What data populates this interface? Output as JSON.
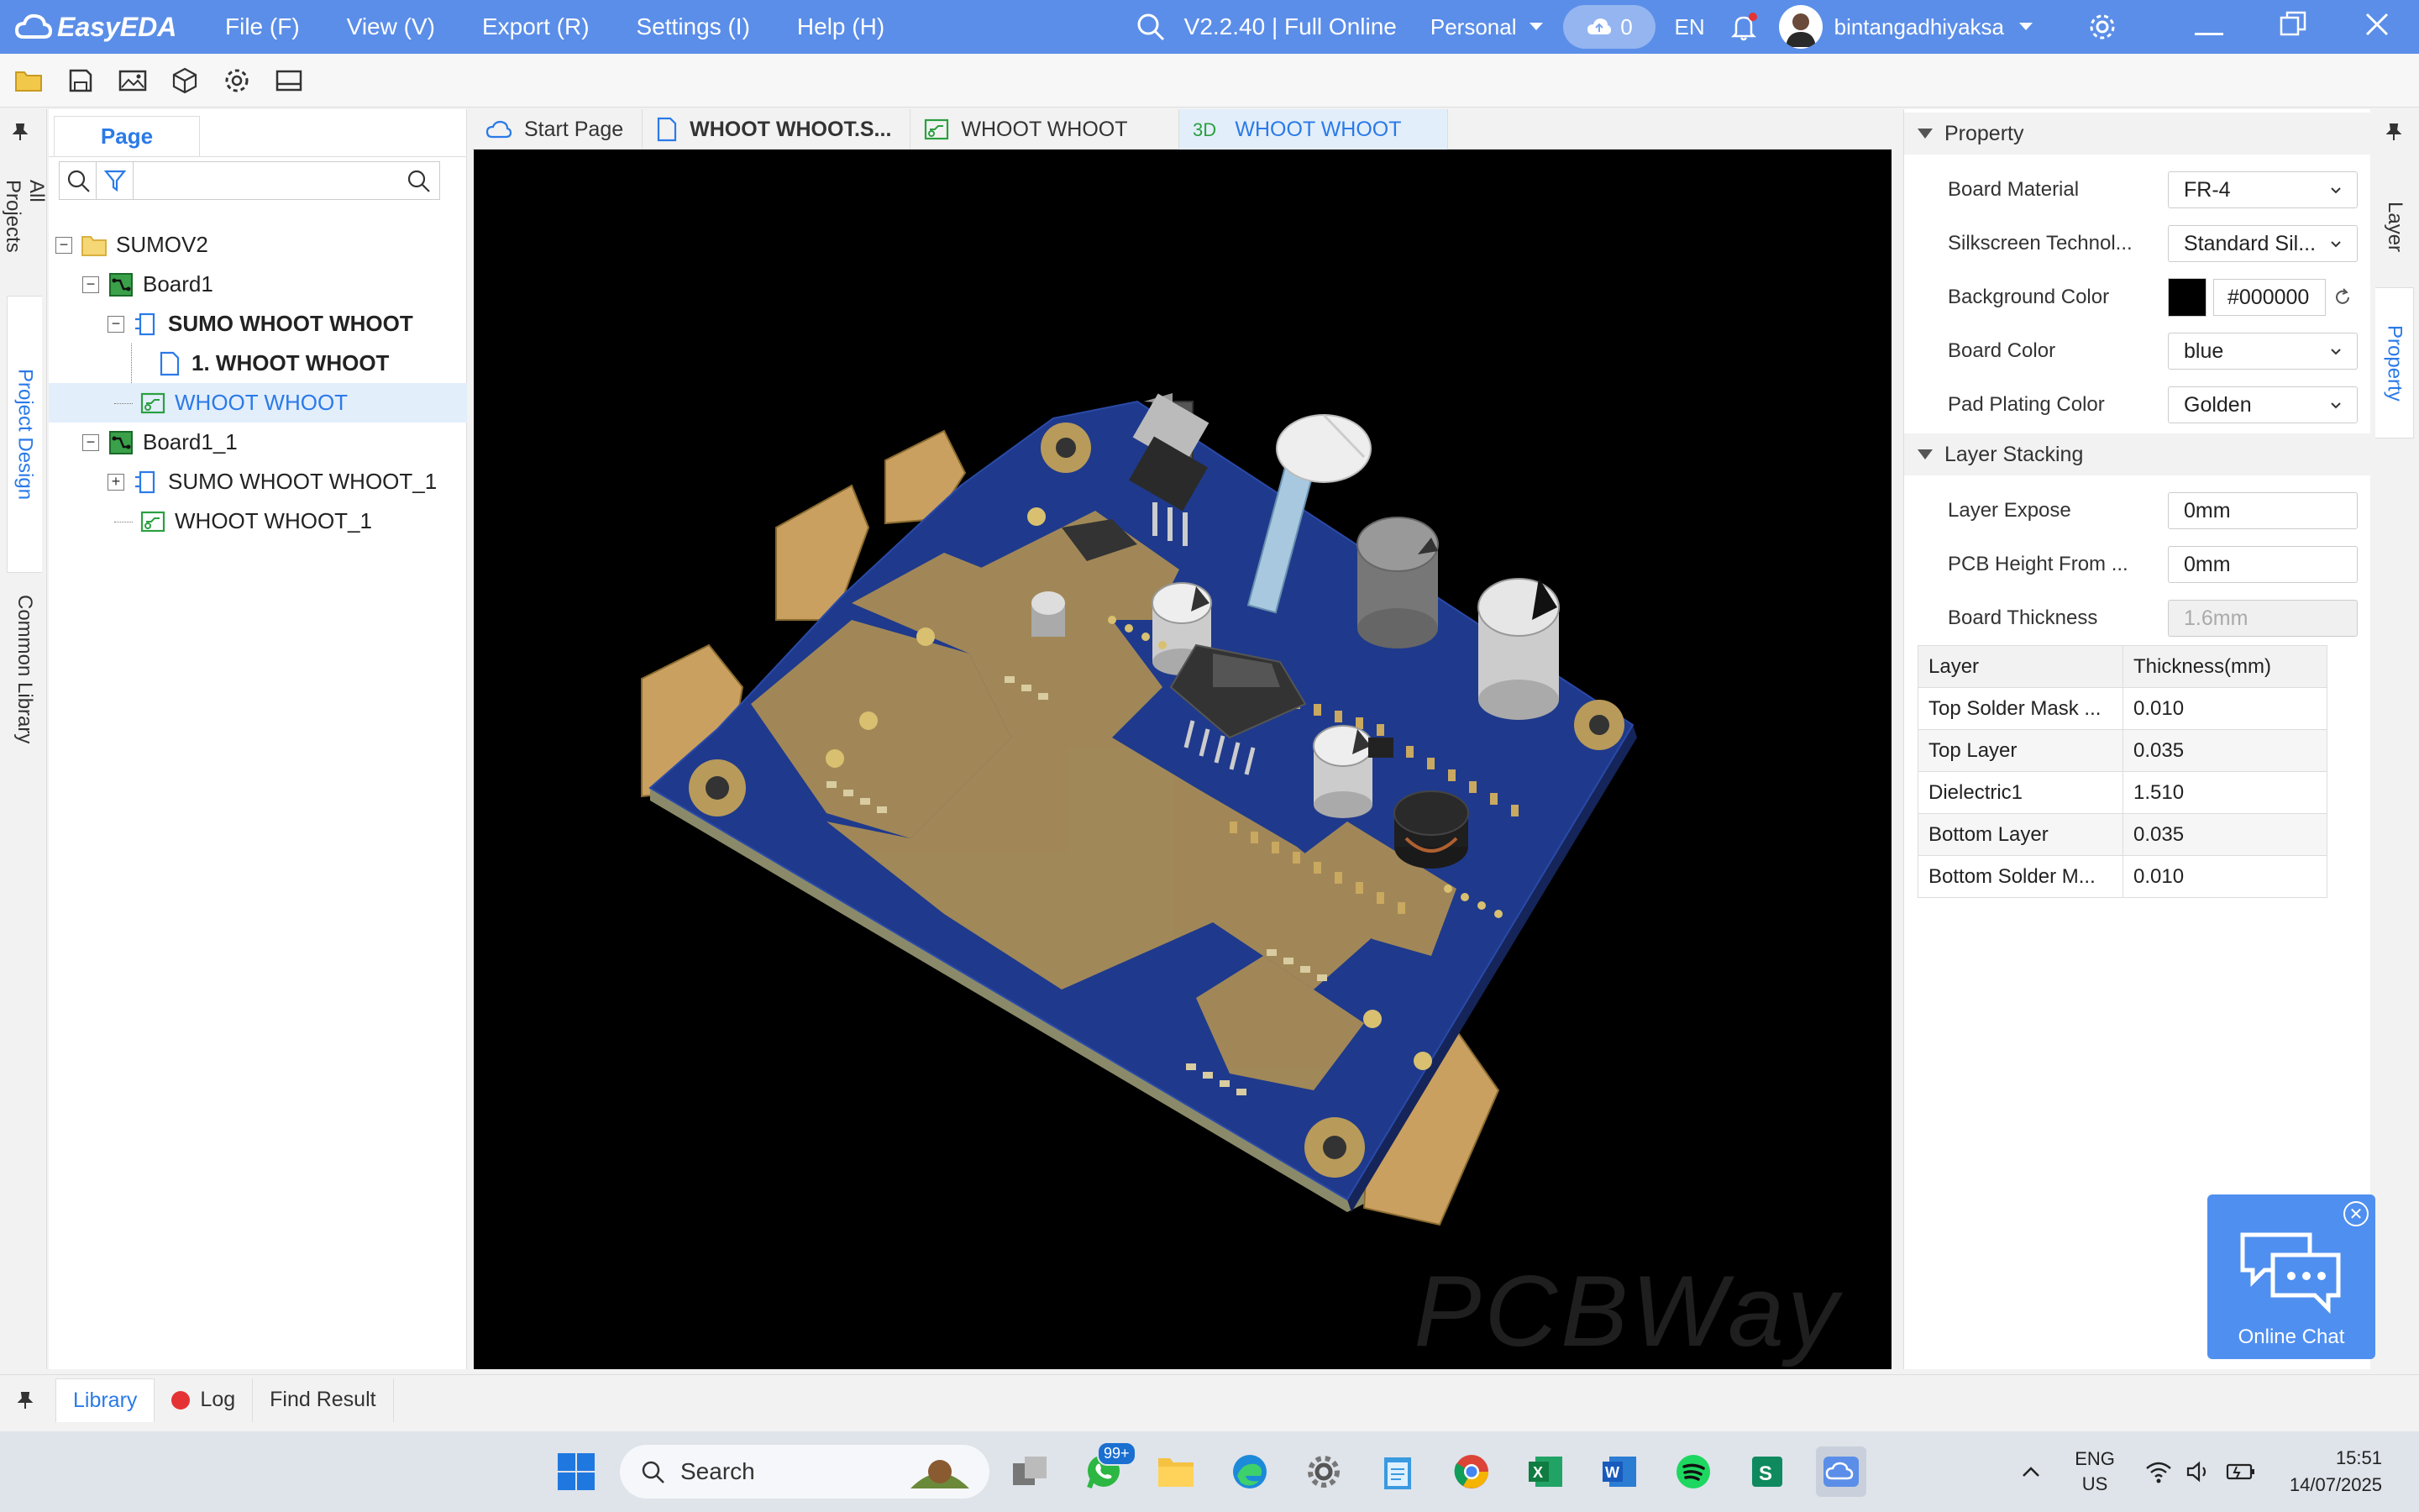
{
  "app": {
    "title": "EasyEDA"
  },
  "menu": [
    "File (F)",
    "View (V)",
    "Export (R)",
    "Settings (I)",
    "Help (H)"
  ],
  "titlebar": {
    "version": "V2.2.40 | Full Online",
    "workspace": "Personal",
    "cloud_count": "0",
    "lang": "EN",
    "username": "bintangadhiyaksa"
  },
  "left_rail": {
    "tabs": [
      "All Projects",
      "Project Design",
      "Common Library"
    ],
    "active": "Project Design"
  },
  "page_panel": {
    "tab": "Page",
    "search_placeholder": ""
  },
  "tree": [
    {
      "label": "SUMOV2",
      "level": 0,
      "icon": "folder",
      "expander": "-"
    },
    {
      "label": "Board1",
      "level": 1,
      "icon": "board",
      "expander": "-"
    },
    {
      "label": "SUMO WHOOT WHOOT",
      "level": 2,
      "icon": "schematic",
      "expander": "-",
      "bold": true
    },
    {
      "label": "1. WHOOT WHOOT",
      "level": 3,
      "icon": "page",
      "bold": true
    },
    {
      "label": "WHOOT WHOOT",
      "level": 2,
      "icon": "pcb",
      "selected": true
    },
    {
      "label": "Board1_1",
      "level": 1,
      "icon": "board",
      "expander": "-"
    },
    {
      "label": "SUMO WHOOT WHOOT_1",
      "level": 2,
      "icon": "schematic",
      "expander": "+"
    },
    {
      "label": "WHOOT WHOOT_1",
      "level": 2,
      "icon": "pcb"
    }
  ],
  "tabs": [
    {
      "label": "Start Page",
      "icon": "cloud"
    },
    {
      "label": "WHOOT WHOOT.S...",
      "icon": "page",
      "bold": true
    },
    {
      "label": "WHOOT WHOOT",
      "icon": "pcb"
    },
    {
      "label": "WHOOT WHOOT",
      "icon": "3d",
      "active": true
    }
  ],
  "property": {
    "section_property": "Property",
    "rows": [
      {
        "label": "Board Material",
        "value": "FR-4",
        "type": "select"
      },
      {
        "label": "Silkscreen Technol...",
        "value": "Standard Sil...",
        "type": "select"
      },
      {
        "label": "Background Color",
        "value": "#000000",
        "type": "color"
      },
      {
        "label": "Board Color",
        "value": "blue",
        "type": "select"
      },
      {
        "label": "Pad Plating Color",
        "value": "Golden",
        "type": "select"
      }
    ],
    "section_layer": "Layer Stacking",
    "layer_rows": [
      {
        "label": "Layer Expose",
        "value": "0mm",
        "disabled": false
      },
      {
        "label": "PCB Height From ...",
        "value": "0mm",
        "disabled": false
      },
      {
        "label": "Board Thickness",
        "value": "1.6mm",
        "disabled": true
      }
    ],
    "table_headers": [
      "Layer",
      "Thickness(mm)"
    ],
    "table_rows": [
      [
        "Top Solder Mask ...",
        "0.010"
      ],
      [
        "Top Layer",
        "0.035"
      ],
      [
        "Dielectric1",
        "1.510"
      ],
      [
        "Bottom Layer",
        "0.035"
      ],
      [
        "Bottom Solder M...",
        "0.010"
      ]
    ]
  },
  "right_rail": {
    "tabs": [
      "Layer",
      "Property"
    ],
    "active": "Property"
  },
  "chat": {
    "label": "Online Chat"
  },
  "watermark": "PCBWay",
  "bottom_tabs": [
    "Library",
    "Log",
    "Find Result"
  ],
  "taskbar": {
    "search": "Search",
    "whatsapp_badge": "99+",
    "lang1": "ENG",
    "lang2": "US",
    "time": "15:51",
    "date": "14/07/2025"
  },
  "colors": {
    "accent": "#5b8ee8",
    "active_text": "#2a7ae8",
    "board": "#1f3a8c",
    "copper": "#b0915a"
  }
}
